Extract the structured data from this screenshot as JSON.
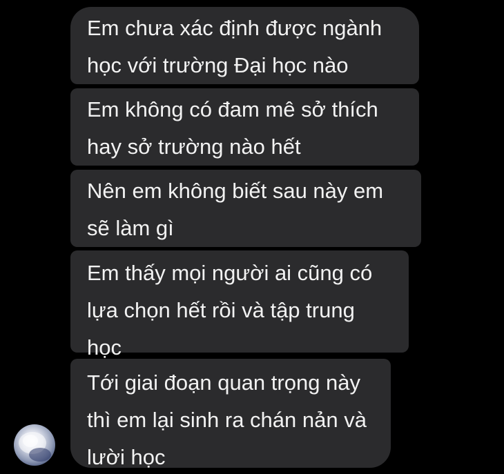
{
  "messages": [
    {
      "text": "Em chưa xác định được ngành\nhọc với trường Đại học nào"
    },
    {
      "text": "Em không có đam mê sở thích\nhay sở trường nào hết"
    },
    {
      "text": "Nên em không biết sau này em\nsẽ làm gì"
    },
    {
      "text": "Em thấy mọi người ai cũng có\nlựa chọn hết rồi và tập trung\nhọc"
    },
    {
      "text": "Tới giai đoạn quan trọng này\nthì em lại sinh ra chán nản và\nlười học"
    }
  ],
  "colors": {
    "background": "#000000",
    "bubble": "#2b2b2d",
    "text": "#f2f2f2"
  },
  "sender": {
    "avatar_icon": "profile-avatar"
  }
}
